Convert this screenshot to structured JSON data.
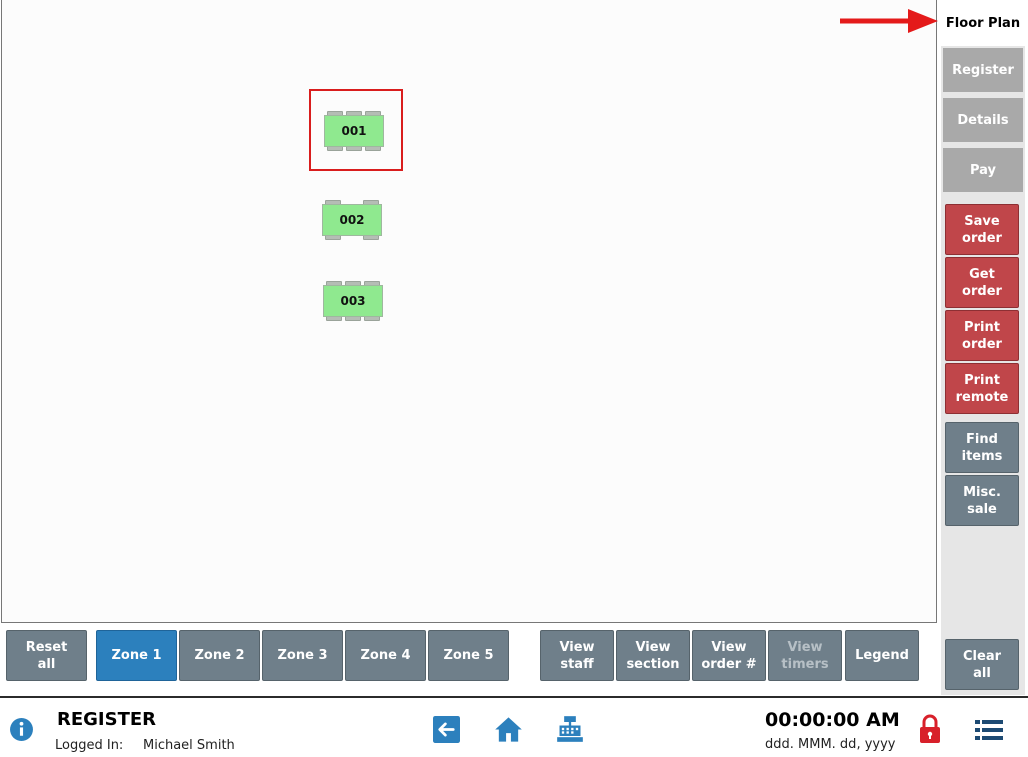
{
  "sidebar": {
    "tabs": [
      {
        "label": "Floor Plan"
      },
      {
        "label": "Register"
      },
      {
        "label": "Details"
      },
      {
        "label": "Pay"
      }
    ],
    "order_buttons": [
      {
        "label": "Save\norder"
      },
      {
        "label": "Get\norder"
      },
      {
        "label": "Print\norder"
      },
      {
        "label": "Print\nremote"
      }
    ],
    "item_buttons": [
      {
        "label": "Find\nitems"
      },
      {
        "label": "Misc.\nsale"
      }
    ],
    "clear_all_label": "Clear\nall"
  },
  "floor": {
    "tables": [
      {
        "number": "001"
      },
      {
        "number": "002"
      },
      {
        "number": "003"
      }
    ],
    "table_color": "#8fe98f",
    "selection_color": "#d91d1d"
  },
  "toolbar": {
    "reset_all": "Reset\nall",
    "zones": [
      {
        "label": "Zone 1"
      },
      {
        "label": "Zone 2"
      },
      {
        "label": "Zone 3"
      },
      {
        "label": "Zone 4"
      },
      {
        "label": "Zone 5"
      }
    ],
    "active_zone": "Zone 1",
    "views": [
      {
        "label": "View\nstaff"
      },
      {
        "label": "View\nsection"
      },
      {
        "label": "View\norder #"
      },
      {
        "label": "View\ntimers"
      },
      {
        "label": "Legend"
      }
    ]
  },
  "footer": {
    "title": "REGISTER",
    "logged_in_label": "Logged In:",
    "user_name": "Michael Smith",
    "clock": "00:00:00 AM",
    "date": "ddd. MMM. dd, yyyy",
    "icons": [
      "info-icon",
      "back-arrow-icon",
      "home-icon",
      "cash-register-icon",
      "lock-icon",
      "menu-list-icon"
    ]
  },
  "colors": {
    "accent_blue": "#2c80bd",
    "order_red": "#c0464a",
    "button_gray": "#6f7f8a",
    "tab_gray": "#a9a9a9",
    "annotation_red": "#e41a1a"
  }
}
